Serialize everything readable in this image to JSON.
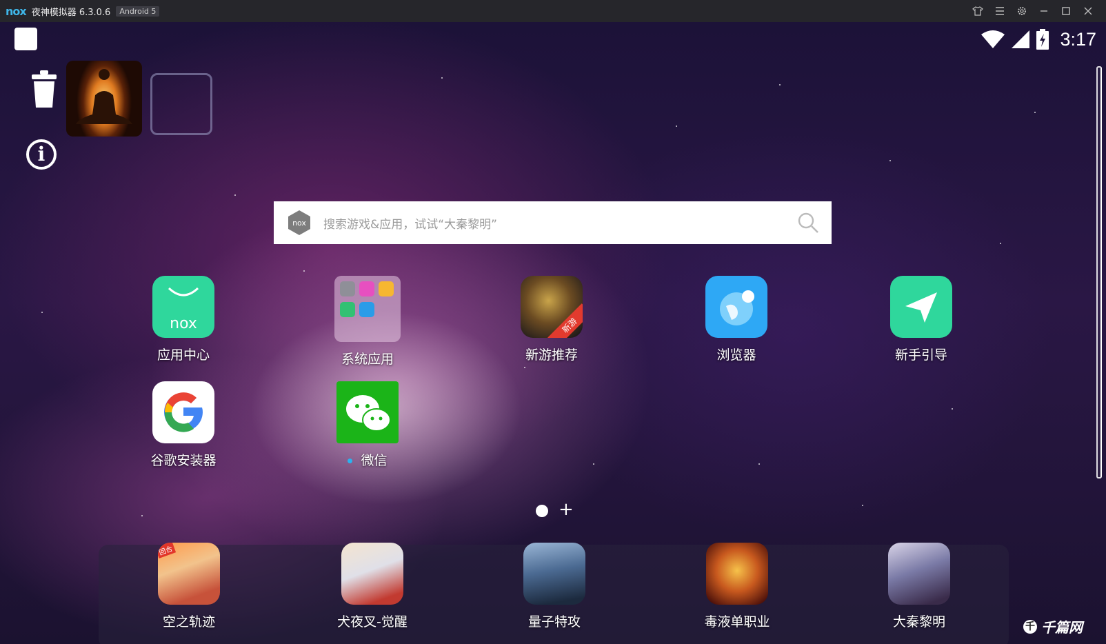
{
  "window": {
    "logo_text": "nox",
    "title": "夜神模拟器 6.3.0.6",
    "android_badge": "Android 5"
  },
  "status": {
    "time": "3:17"
  },
  "search": {
    "placeholder": "搜索游戏&应用，试试“大秦黎明”"
  },
  "apps_row1": [
    "应用中心",
    "系统应用",
    "新游推荐",
    "浏览器",
    "新手引导"
  ],
  "apps_row2": [
    "谷歌安装器",
    "微信"
  ],
  "game_badge": "新游",
  "page_plus": "+",
  "dock": [
    "空之轨迹",
    "犬夜叉-觉醒",
    "量子特攻",
    "毒液单职业",
    "大秦黎明"
  ],
  "dock_badge": "回合",
  "watermark": "千篇网",
  "colors": {
    "accent_green": "#2fd79c",
    "browser_blue": "#2ea8f5",
    "wechat_green": "#1bb418"
  }
}
